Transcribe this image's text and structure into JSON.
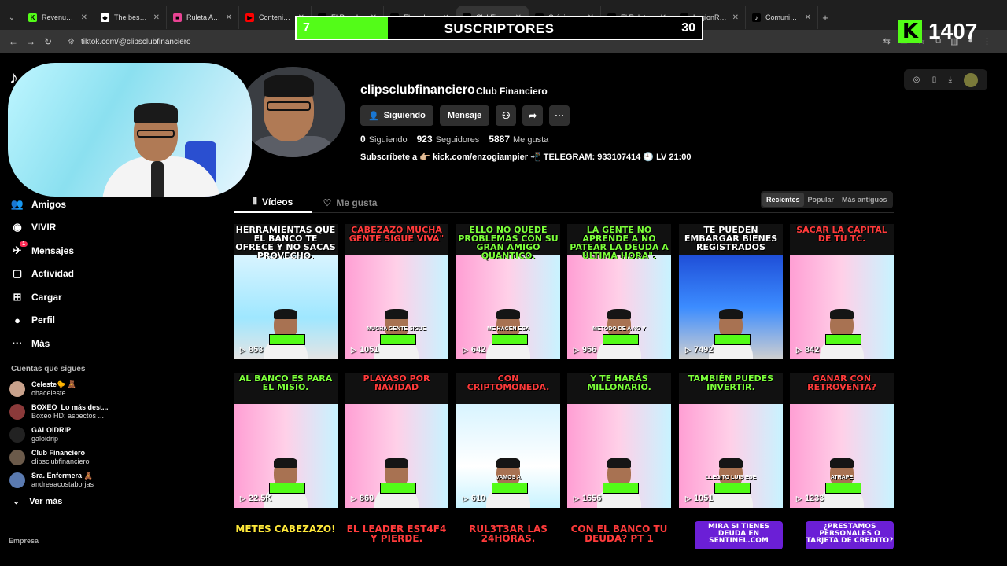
{
  "browser": {
    "tabs": [
      {
        "title": "Revenue - K",
        "fav_color": "#53fc18",
        "fav_text": "K"
      },
      {
        "title": "The best Cli",
        "fav_color": "#ffffff",
        "fav_text": "◆"
      },
      {
        "title": "Ruleta Aleat",
        "fav_color": "#e84393",
        "fav_text": "■"
      },
      {
        "title": "Contenido d",
        "fav_color": "#ff0000",
        "fav_text": "▶"
      },
      {
        "title": "El Rey del C",
        "fav_color": "#000000",
        "fav_text": "♪"
      },
      {
        "title": "Elrey.delmilo",
        "fav_color": "#000000",
        "fav_text": "♪"
      },
      {
        "title": "ClubFinancie",
        "fav_color": "#000000",
        "fav_text": "♪"
      },
      {
        "title": "Crónicas de",
        "fav_color": "#000000",
        "fav_text": "♪"
      },
      {
        "title": "El Ruletero",
        "fav_color": "#000000",
        "fav_text": "♪"
      },
      {
        "title": "LegionRuleta",
        "fav_color": "#000000",
        "fav_text": "♪"
      },
      {
        "title": "Comunidad",
        "fav_color": "#000000",
        "fav_text": "♪"
      }
    ],
    "url": "tiktok.com/@clipsclubfinanciero"
  },
  "overlay": {
    "sub_current": "7",
    "sub_title": "SUSCRIPTORES",
    "sub_goal": "30",
    "sub_progress": 0.225,
    "kick_logo": "K",
    "kick_count": "1407"
  },
  "tiktok": {
    "logo": "♪",
    "sidebar": [
      {
        "label": "Amigos",
        "icon": "friends-icon",
        "glyph": "👥"
      },
      {
        "label": "VIVIR",
        "icon": "live-icon",
        "glyph": "◉"
      },
      {
        "label": "Mensajes",
        "icon": "messages-icon",
        "glyph": "✈",
        "badge": "1"
      },
      {
        "label": "Actividad",
        "icon": "activity-icon",
        "glyph": "▢"
      },
      {
        "label": "Cargar",
        "icon": "upload-icon",
        "glyph": "⊞"
      },
      {
        "label": "Perfil",
        "icon": "profile-icon",
        "glyph": "●"
      },
      {
        "label": "Más",
        "icon": "more-icon",
        "glyph": "···"
      }
    ],
    "following_heading": "Cuentas que sigues",
    "following": [
      {
        "name": "Celeste🐤 🧸",
        "handle": "ohaceleste",
        "color": "#c9a28c"
      },
      {
        "name": "BOXEO_Lo más dest...",
        "handle": "Boxeo HD: aspectos ...",
        "color": "#8b3a3a"
      },
      {
        "name": "GALOIDRIP",
        "handle": "galoidrip",
        "color": "#222222"
      },
      {
        "name": "Club Financiero",
        "handle": "clipsclubfinanciero",
        "color": "#6b5a4a"
      },
      {
        "name": "Sra. Enfermera 🧸",
        "handle": "andreaacostaborjas",
        "color": "#5a7ab0"
      }
    ],
    "see_more": "Ver más",
    "footer": "Empresa",
    "profile": {
      "username": "clipsclubfinanciero",
      "display_name": "Club Financiero",
      "following_btn": "Siguiendo",
      "message_btn": "Mensaje",
      "following_count": "0",
      "following_label": "Siguiendo",
      "followers_count": "923",
      "followers_label": "Seguidores",
      "likes_count": "5887",
      "likes_label": "Me gusta",
      "bio": "Subscríbete a 👉🏼 kick.com/enzogiampier 📲 TELEGRAM: 933107414 🕘 LV 21:00"
    },
    "tabs": [
      {
        "label": "Vídeos",
        "icon": "grid-icon",
        "glyph": "⦀"
      },
      {
        "label": "Me gusta",
        "icon": "heart-icon",
        "glyph": "♡"
      }
    ],
    "sort": [
      "Recientes",
      "Popular",
      "Más antiguos"
    ],
    "videos": [
      {
        "caption": "HERRAMIENTAS QUE EL BANCO TE OFRECE Y NO SACAS PROVECHO.",
        "cap_color": "#ffffff",
        "subtitle": "",
        "views": "853",
        "bg": "linear-gradient(180deg,#d8f4ff,#9fe7ff 60%,#e4e4e4)"
      },
      {
        "caption": "CABEZAZO MUCHA GENTE SIGUE VIVA\"",
        "cap_color": "#ff3b3b",
        "subtitle": "MUCHA GENTE SIGUE",
        "views": "1051",
        "bg": "linear-gradient(90deg,#ff9fd4,#ffd0e8 50%,#c8f3ff)"
      },
      {
        "caption": "ELLO NO QUEDE PROBLEMAS CON SU GRAN AMIGO QUANTICO.",
        "cap_color": "#7cff3a",
        "subtitle": "ME HACEN ESA",
        "views": "642",
        "bg": "linear-gradient(90deg,#ff9fd4,#ffd0e8 50%,#c8f3ff)"
      },
      {
        "caption": "LA GENTE NO APRENDE A NO PATEAR LA DEUDA A ÚLTIMA HORA\".",
        "cap_color": "#7cff3a",
        "subtitle": "METODO DE A NO Y",
        "views": "956",
        "bg": "linear-gradient(90deg,#ff9fd4,#ffd0e8 50%,#c8f3ff)"
      },
      {
        "caption": "TE PUEDEN EMBARGAR BIENES REGISTRADOS",
        "cap_color": "#ffffff",
        "subtitle": "",
        "views": "7492",
        "bg": "linear-gradient(180deg,#1f4fd8,#3c8cff 50%,#cfcfcf)"
      },
      {
        "caption": "SACAR LA CAPITAL DE TU TC.",
        "cap_color": "#ff3b3b",
        "subtitle": "",
        "views": "842",
        "bg": "linear-gradient(90deg,#ff9fd4,#ffd0e8 50%,#c8f3ff)"
      },
      {
        "caption": "AL BANCO ES PARA EL MISIO.",
        "cap_color": "#7cff3a",
        "subtitle": "",
        "views": "22.5K",
        "bg": "linear-gradient(90deg,#ff9fd4,#ffd0e8 50%,#c8f3ff)"
      },
      {
        "caption": "PLAYASO POR NAVIDAD",
        "cap_color": "#ff3b3b",
        "subtitle": "",
        "views": "860",
        "bg": "linear-gradient(90deg,#ff9fd4,#ffd0e8 50%,#c8f3ff)"
      },
      {
        "caption": "CON CRIPTOMONEDA.",
        "cap_color": "#ff3b3b",
        "subtitle": "VAMOS A",
        "views": "610",
        "bg": "linear-gradient(180deg,#d8f4ff,#ffffff 60%,#c8f3ff)"
      },
      {
        "caption": "Y TE HARÁS MILLONARIO.",
        "cap_color": "#7cff3a",
        "subtitle": "",
        "views": "1656",
        "bg": "linear-gradient(90deg,#ff9fd4,#ffd0e8 50%,#c8f3ff)"
      },
      {
        "caption": "TAMBIÉN PUEDES INVERTIR.",
        "cap_color": "#7cff3a",
        "subtitle": "LLEGITO LUIS ESE",
        "views": "1051",
        "bg": "linear-gradient(90deg,#ff9fd4,#ffd0e8 50%,#c8f3ff)"
      },
      {
        "caption": "GANAR CON RETROVENTA?",
        "cap_color": "#ff3b3b",
        "subtitle": "ATRAPE",
        "views": "1233",
        "bg": "linear-gradient(90deg,#ff9fd4,#ffd0e8 50%,#c8f3ff)"
      }
    ],
    "bottom_row": [
      {
        "caption": "METES CABEZAZO!",
        "cap_color": "#ffe93a",
        "boxed": false
      },
      {
        "caption": "EL LEADER EST4F4 Y PIERDE.",
        "cap_color": "#ff3b3b",
        "boxed": false
      },
      {
        "caption": "RUL3T3AR LAS 24HORAS.",
        "cap_color": "#ff3b3b",
        "boxed": false
      },
      {
        "caption": "CON EL BANCO TU DEUDA? PT 1",
        "cap_color": "#ff3b3b",
        "boxed": false
      },
      {
        "caption": "MIRA SI TIENES DEUDA EN SENTINEL.COM",
        "cap_color": "#ffffff",
        "boxed": true
      },
      {
        "caption": "¿PRESTAMOS PERSONALES O TARJETA DE CREDITO?",
        "cap_color": "#ffffff",
        "boxed": true
      }
    ]
  }
}
